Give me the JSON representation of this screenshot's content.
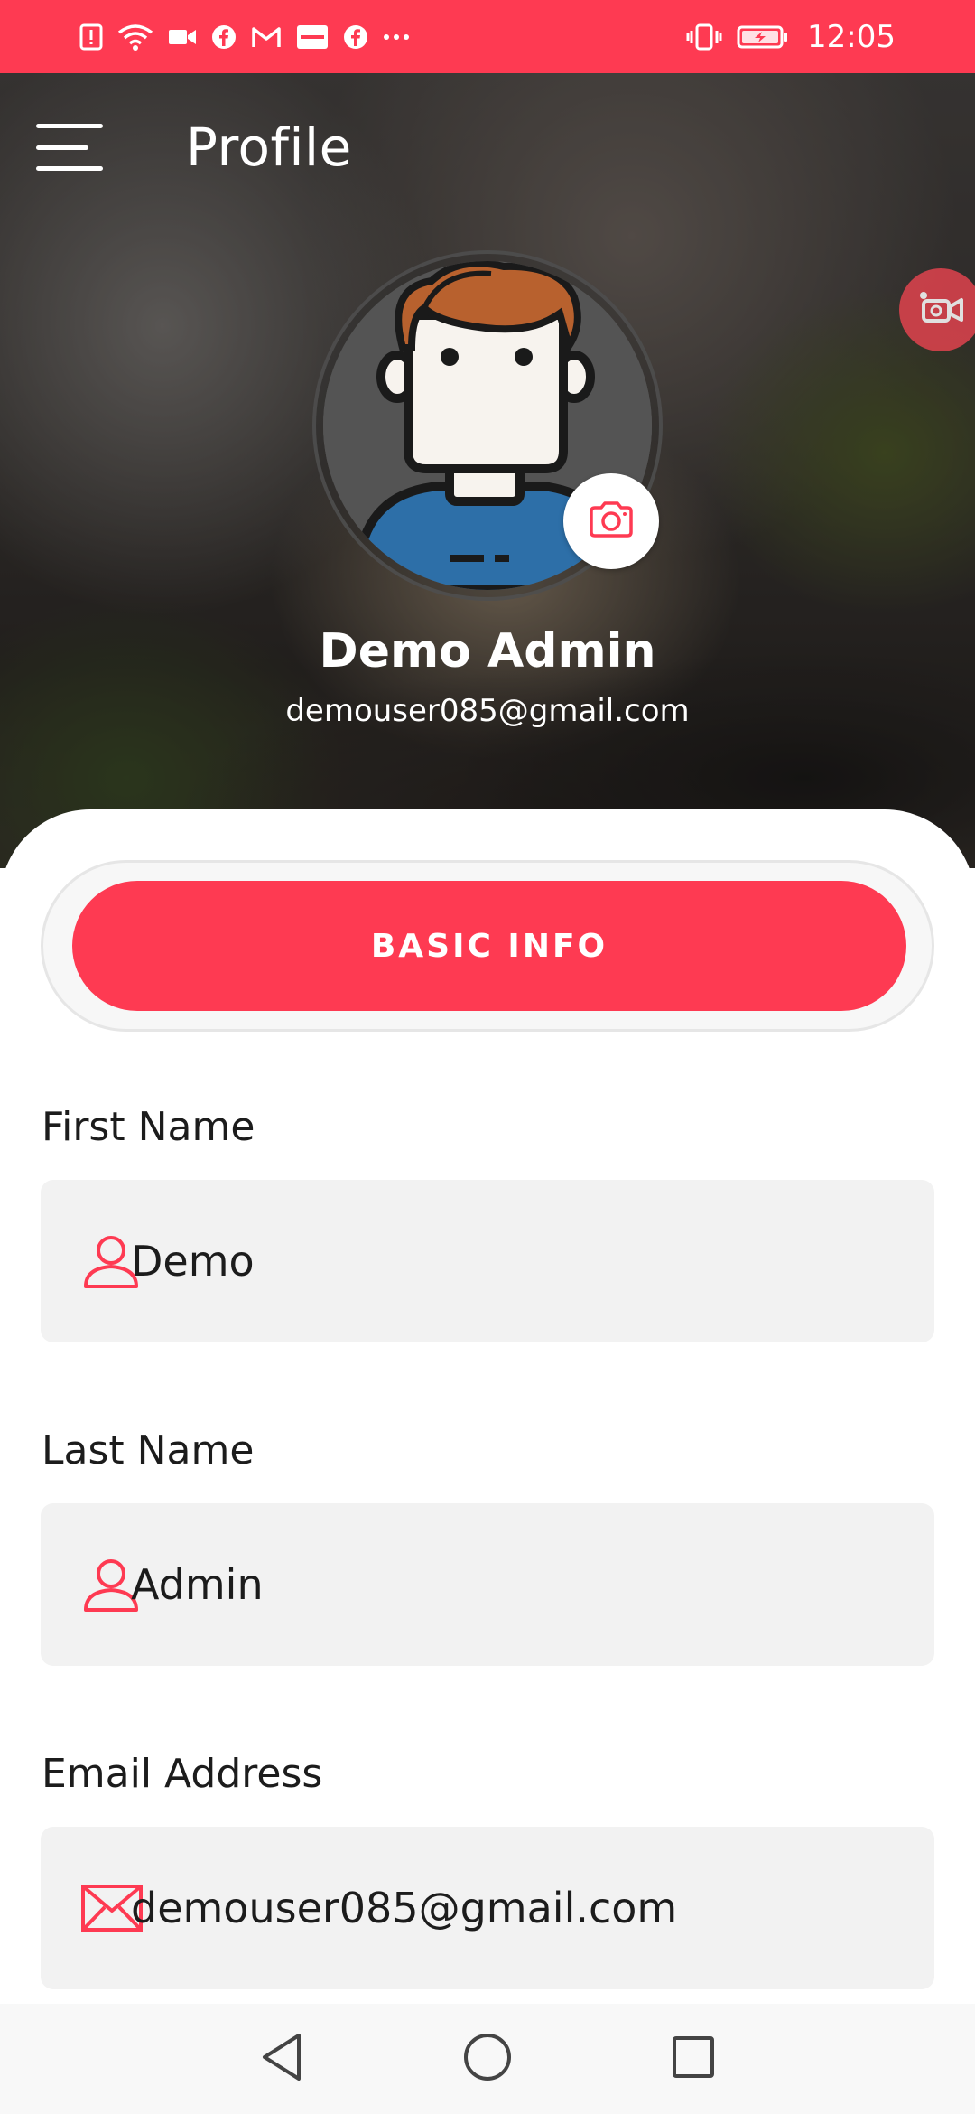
{
  "status_bar": {
    "time": "12:05",
    "left_icons": [
      "alert-icon",
      "wifi-icon",
      "video-icon",
      "facebook-icon",
      "gmail-icon",
      "zomato-icon",
      "facebook-icon",
      "more-icon"
    ],
    "right_icons": [
      "vibrate-icon",
      "battery-charging-icon"
    ]
  },
  "header": {
    "title": "Profile"
  },
  "profile": {
    "name": "Demo Admin",
    "email": "demouser085@gmail.com"
  },
  "tabs": {
    "basic_info": "BASIC INFO"
  },
  "form": {
    "first_name_label": "First Name",
    "first_name_value": "Demo",
    "last_name_label": "Last Name",
    "last_name_value": "Admin",
    "email_label": "Email Address",
    "email_value": "demouser085@gmail.com"
  },
  "colors": {
    "accent": "#fe3a52",
    "field_bg": "#f2f2f2",
    "nav_bg": "#f8f8f8"
  },
  "navigation": [
    "back-icon",
    "home-icon",
    "recents-icon"
  ]
}
